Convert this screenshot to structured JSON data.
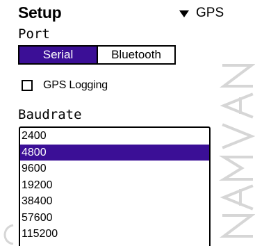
{
  "header": {
    "title": "Setup",
    "category": "GPS"
  },
  "port": {
    "label": "Port",
    "options": [
      "Serial",
      "Bluetooth"
    ],
    "selected": "Serial"
  },
  "gps_logging": {
    "label": "GPS Logging",
    "checked": false
  },
  "baudrate": {
    "label": "Baudrate",
    "options": [
      "2400",
      "4800",
      "9600",
      "19200",
      "38400",
      "57600",
      "115200"
    ],
    "selected": "4800"
  },
  "watermark": {
    "text": "NAVMAN"
  },
  "colors": {
    "selection": "#3b0f96",
    "watermark": "#d6d6d6"
  },
  "icons": {
    "category_dropdown": "triangle-down-icon",
    "checkbox": "checkbox-unchecked-icon"
  }
}
